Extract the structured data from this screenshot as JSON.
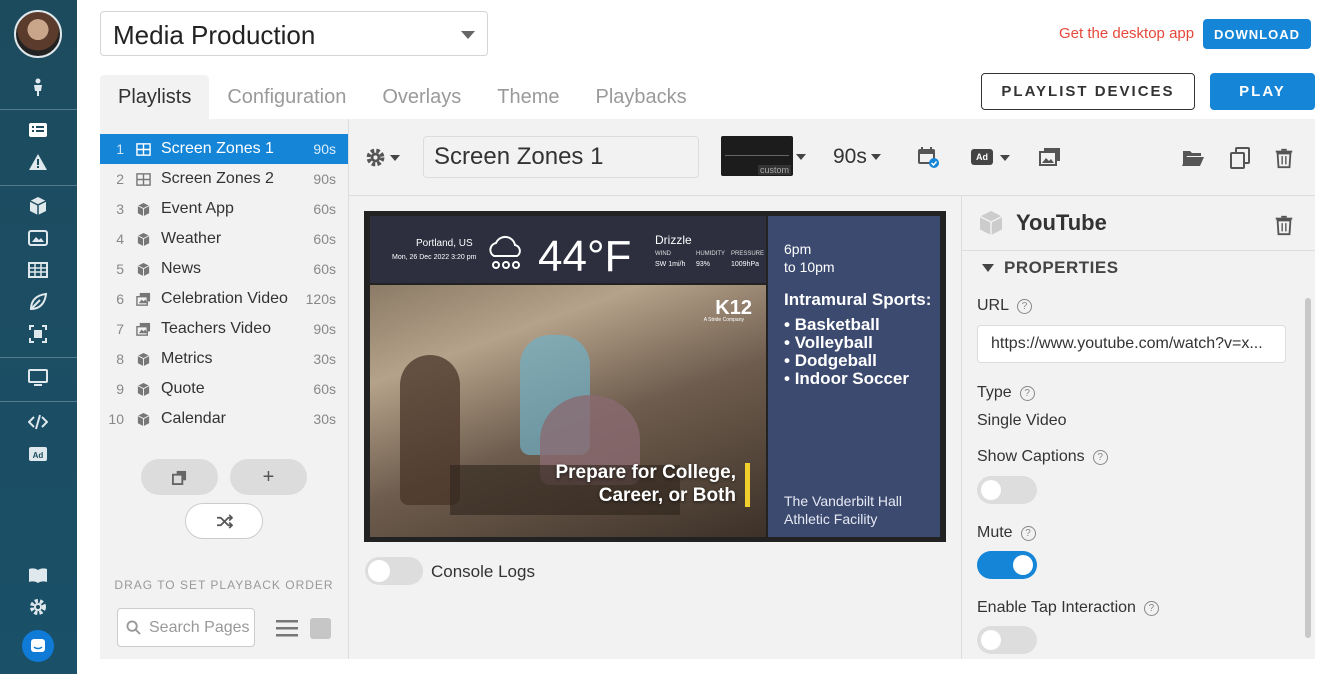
{
  "project": {
    "name": "Media Production"
  },
  "header": {
    "get_app_text": "Get the desktop app",
    "download_label": "DOWNLOAD"
  },
  "tabs": [
    {
      "label": "Playlists",
      "active": true
    },
    {
      "label": "Configuration"
    },
    {
      "label": "Overlays"
    },
    {
      "label": "Theme"
    },
    {
      "label": "Playbacks"
    }
  ],
  "actions": {
    "devices_label": "PLAYLIST DEVICES",
    "play_label": "PLAY"
  },
  "playlist": [
    {
      "num": "1",
      "name": "Screen Zones 1",
      "duration": "90s",
      "icon": "zones-icon",
      "selected": true
    },
    {
      "num": "2",
      "name": "Screen Zones 2",
      "duration": "90s",
      "icon": "zones-icon"
    },
    {
      "num": "3",
      "name": "Event App",
      "duration": "60s",
      "icon": "app-cube-icon"
    },
    {
      "num": "4",
      "name": "Weather",
      "duration": "60s",
      "icon": "app-cube-icon"
    },
    {
      "num": "5",
      "name": "News",
      "duration": "60s",
      "icon": "app-cube-icon"
    },
    {
      "num": "6",
      "name": "Celebration Video",
      "duration": "120s",
      "icon": "media-icon"
    },
    {
      "num": "7",
      "name": "Teachers Video",
      "duration": "90s",
      "icon": "media-icon"
    },
    {
      "num": "8",
      "name": "Metrics",
      "duration": "30s",
      "icon": "app-cube-icon"
    },
    {
      "num": "9",
      "name": "Quote",
      "duration": "60s",
      "icon": "app-cube-icon"
    },
    {
      "num": "10",
      "name": "Calendar",
      "duration": "30s",
      "icon": "app-cube-icon"
    }
  ],
  "sidebar_controls": {
    "add_symbol": "+",
    "drag_label": "DRAG TO SET PLAYBACK ORDER",
    "search_placeholder": "Search Pages"
  },
  "editor": {
    "zone_name": "Screen Zones 1",
    "layout_tag": "custom",
    "duration": "90s",
    "ad_badge": "Ad"
  },
  "preview": {
    "weather": {
      "location": "Portland, US",
      "date": "Mon, 26 Dec 2022 3:20 pm",
      "temperature": "44°F",
      "condition": "Drizzle",
      "stats": [
        {
          "label": "WIND",
          "value": "SW 1mi/h"
        },
        {
          "label": "HUMIDITY",
          "value": "93%"
        },
        {
          "label": "PRESSURE",
          "value": "1009hPa"
        }
      ]
    },
    "video": {
      "logo": "K12",
      "logo_sub": "A Stride Company",
      "promo_line1": "Prepare for College,",
      "promo_line2": "Career, or Both"
    },
    "side": {
      "time_line1": "6pm",
      "time_line2": "to 10pm",
      "heading": "Intramural Sports:",
      "items": [
        "Basketball",
        "Volleyball",
        "Dodgeball",
        "Indoor Soccer"
      ],
      "venue_line1": "The Vanderbilt Hall",
      "venue_line2": "Athletic Facility"
    }
  },
  "console": {
    "label": "Console Logs",
    "enabled": false
  },
  "properties": {
    "zone_title": "YouTube",
    "section_label": "PROPERTIES",
    "url_label": "URL",
    "url_value": "https://www.youtube.com/watch?v=x...",
    "type_label": "Type",
    "type_value": "Single Video",
    "captions_label": "Show Captions",
    "captions_on": false,
    "mute_label": "Mute",
    "mute_on": true,
    "tap_label": "Enable Tap Interaction",
    "tap_on": false,
    "help_glyph": "?"
  },
  "colors": {
    "accent": "#1585d8",
    "rail": "#1d4b5e",
    "promo_bar": "#f1d02d",
    "link": "#e5493a"
  }
}
